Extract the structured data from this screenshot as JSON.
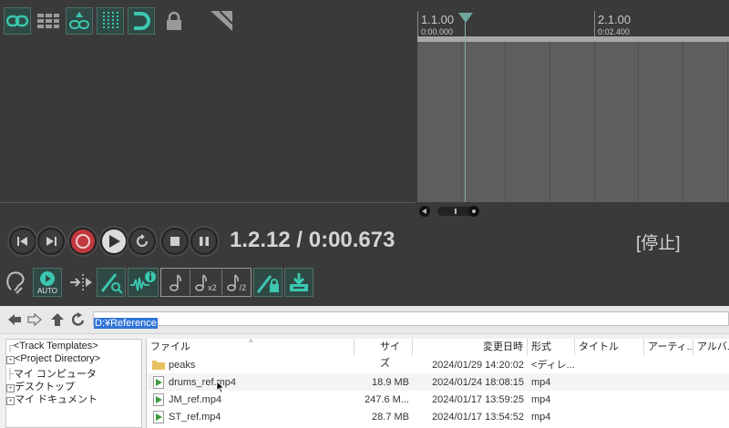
{
  "ruler": {
    "markers": [
      {
        "bar": "1.1.00",
        "time": "0:00.000"
      },
      {
        "bar": "2.1.00",
        "time": "0:02.400"
      }
    ]
  },
  "transport": {
    "position": "1.2.12 / 0:00.673",
    "status": "[停止]",
    "auto_label": "AUTO",
    "badge_x2": "x2",
    "badge_div2": "/2"
  },
  "explorer": {
    "path": "D:¥Reference",
    "tree": [
      "<Track Templates>",
      "<Project Directory>",
      "マイ コンピュータ",
      "デスクトップ",
      "マイ ドキュメント"
    ],
    "columns": [
      "ファイル",
      "サイズ",
      "変更日時",
      "形式",
      "タイトル",
      "アーティ...",
      "アルバム"
    ],
    "files": [
      {
        "name": "peaks",
        "size": "",
        "date": "2024/01/29 14:20:02",
        "type": "<ディレ...",
        "kind": "folder"
      },
      {
        "name": "drums_ref.mp4",
        "size": "18.9 MB",
        "date": "2024/01/24 18:08:15",
        "type": "mp4",
        "kind": "media"
      },
      {
        "name": "JM_ref.mp4",
        "size": "247.6 M...",
        "date": "2024/01/17 13:59:25",
        "type": "mp4",
        "kind": "media"
      },
      {
        "name": "ST_ref.mp4",
        "size": "28.7 MB",
        "date": "2024/01/17 13:54:52",
        "type": "mp4",
        "kind": "media"
      }
    ]
  },
  "colors": {
    "accent": "#2f4a45",
    "teal_icon": "#3bc7b0",
    "record": "#c0393f"
  }
}
